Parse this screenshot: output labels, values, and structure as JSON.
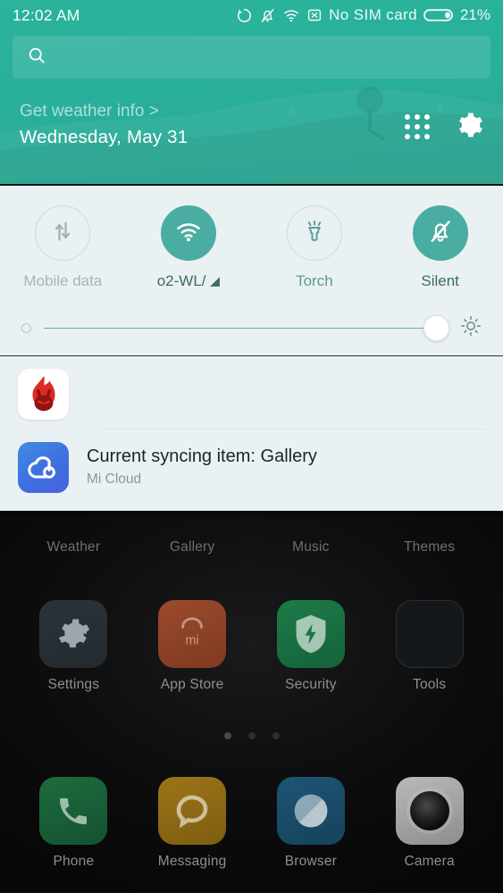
{
  "statusbar": {
    "clock": "12:02 AM",
    "icons": [
      "sync-icon",
      "notifications-off-icon",
      "wifi-icon",
      "no-sim-icon"
    ],
    "carrier": "No SIM card",
    "battery_percent": "21%",
    "battery_level": 21
  },
  "search": {
    "placeholder": "",
    "value": "",
    "icon": "search-icon"
  },
  "header": {
    "weather_link": "Get weather info >",
    "date": "Wednesday, May 31",
    "apps_icon": "apps-grid-icon",
    "settings_icon": "gear-icon",
    "background_color": "#2bb39b"
  },
  "quick_settings": {
    "toggles": [
      {
        "label": "Mobile data",
        "icon": "data-transfer-icon",
        "state": "off",
        "tinted": false
      },
      {
        "label": "o2-WL/",
        "icon": "wifi-icon",
        "state": "on",
        "tinted": false
      },
      {
        "label": "Torch",
        "icon": "torch-icon",
        "state": "off",
        "tinted": true
      },
      {
        "label": "Silent",
        "icon": "bell-off-icon",
        "state": "on",
        "tinted": false
      }
    ],
    "brightness": {
      "value": 97,
      "min_icon": "brightness-low-icon",
      "max_icon": "brightness-high-icon"
    },
    "accent_color": "#4aada2",
    "panel_color": "#eaf1f3"
  },
  "notifications": [
    {
      "app_icon": "antutu-icon",
      "title": "",
      "subtitle": ""
    },
    {
      "app_icon": "mi-cloud-icon",
      "title": "Current syncing item: Gallery",
      "subtitle": "Mi Cloud"
    }
  ],
  "homescreen": {
    "rows": [
      {
        "apps": [
          {
            "label": "Weather",
            "icon": "weather-app-icon"
          },
          {
            "label": "Gallery",
            "icon": "gallery-app-icon"
          },
          {
            "label": "Music",
            "icon": "music-app-icon"
          },
          {
            "label": "Themes",
            "icon": "themes-app-icon"
          }
        ]
      },
      {
        "apps": [
          {
            "label": "Settings",
            "icon": "settings-app-icon"
          },
          {
            "label": "App Store",
            "icon": "app-store-icon"
          },
          {
            "label": "Security",
            "icon": "security-app-icon"
          },
          {
            "label": "Tools",
            "icon": "tools-folder-icon"
          }
        ]
      },
      {
        "apps": [
          {
            "label": "Phone",
            "icon": "phone-app-icon"
          },
          {
            "label": "Messaging",
            "icon": "messaging-app-icon"
          },
          {
            "label": "Browser",
            "icon": "browser-app-icon"
          },
          {
            "label": "Camera",
            "icon": "camera-app-icon"
          }
        ]
      }
    ],
    "page_dots": {
      "count": 3,
      "active_index": 0
    }
  }
}
